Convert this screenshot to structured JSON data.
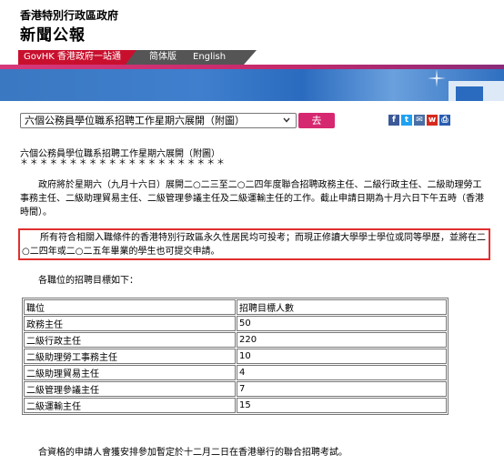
{
  "header": {
    "gov_name": "香港特別行政區政府",
    "press_title": "新聞公報"
  },
  "nav": {
    "govhk": "GovHK 香港政府一站通",
    "simplified": "简体版",
    "english": "English"
  },
  "toolbar": {
    "selected_article": "六個公務員學位職系招聘工作星期六展開（附圖）",
    "go_label": "去",
    "share_icons": [
      "facebook-icon",
      "twitter-icon",
      "email-icon",
      "weibo-icon",
      "print-icon"
    ]
  },
  "article": {
    "heading": "六個公務員學位職系招聘工作星期六展開（附圖）",
    "stars": "＊＊＊＊＊＊＊＊＊＊＊＊＊＊＊＊＊＊＊＊＊",
    "para1": "政府將於星期六（九月十六日）展開二○二三至二○二四年度聯合招聘政務主任、二級行政主任、二級助理勞工事務主任、二級助理貿易主任、二級管理參議主任及二級運輸主任的工作。截止申請日期為十月六日下午五時（香港時間）。",
    "para2": "所有符合相關入職條件的香港特別行政區永久性居民均可投考；而現正修讀大學學士學位或同等學歷，並將在二○二四年或二○二五年畢業的學生也可提交申請。",
    "para3": "各職位的招聘目標如下：",
    "para4": "合資格的申請人會獲安排參加暫定於十二月二日在香港舉行的聯合招聘考試。"
  },
  "table": {
    "headers": [
      "職位",
      "招聘目標人數"
    ],
    "rows": [
      [
        "政務主任",
        "50"
      ],
      [
        "二級行政主任",
        "220"
      ],
      [
        "二級助理勞工事務主任",
        "10"
      ],
      [
        "二級助理貿易主任",
        "4"
      ],
      [
        "二級管理參議主任",
        "7"
      ],
      [
        "二級運輸主任",
        "15"
      ]
    ]
  },
  "colors": {
    "accent_red": "#c8102e",
    "go_button": "#d62870",
    "notice_border": "#e0302f",
    "banner_blue": "#3b78c2"
  }
}
